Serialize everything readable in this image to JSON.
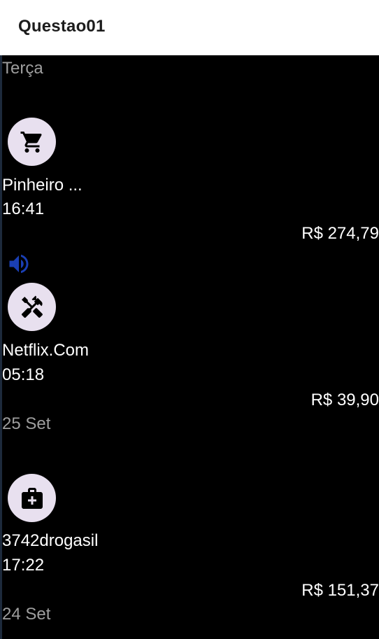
{
  "app_bar": {
    "title": "Questao01"
  },
  "groups": [
    {
      "date": "Terça",
      "transactions": [
        {
          "icon": "shopping-cart-icon",
          "merchant": "Pinheiro ...",
          "time": "16:41",
          "amount": "R$ 274,79"
        },
        {
          "icon": "tools-icon",
          "merchant": "Netflix.Com",
          "time": "05:18",
          "amount": "R$ 39,90"
        }
      ]
    },
    {
      "date": "25 Set",
      "transactions": [
        {
          "icon": "medical-bag-icon",
          "merchant": "3742drogasil",
          "time": "17:22",
          "amount": "R$ 151,37"
        }
      ]
    },
    {
      "date": "24 Set",
      "transactions": []
    }
  ],
  "colors": {
    "app_bar_bg": "#ffffff",
    "background": "#000000",
    "avatar_bg": "#e8e0ef",
    "date_text": "#9e9e9e",
    "speaker_icon": "#1a3fb4"
  }
}
